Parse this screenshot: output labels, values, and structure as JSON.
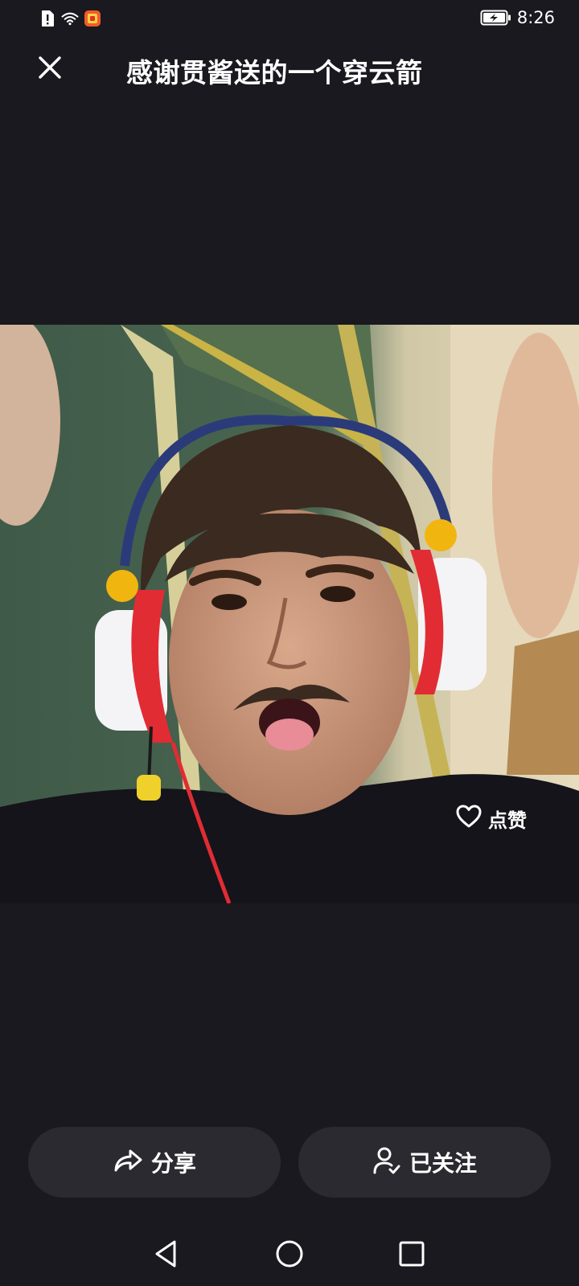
{
  "status_bar": {
    "time": "8:26",
    "left_icons": [
      "sim-alert-icon",
      "wifi-icon",
      "app-notification-icon"
    ],
    "right_icons": [
      "battery-charging-icon"
    ]
  },
  "header": {
    "title": "感谢贯酱送的一个穿云箭",
    "close_icon": "close-icon"
  },
  "video": {
    "description_icon": "video-frame"
  },
  "like_button": {
    "label": "点赞",
    "icon": "heart-icon"
  },
  "actions": {
    "share_label": "分享",
    "share_icon": "share-arrow-icon",
    "follow_label": "已关注",
    "follow_icon": "user-check-icon"
  },
  "nav": {
    "back_icon": "back-triangle-icon",
    "home_icon": "home-circle-icon",
    "recent_icon": "recent-square-icon"
  },
  "colors": {
    "background": "#19191f",
    "button_bg": "#2a2a30",
    "text": "#ffffff"
  }
}
